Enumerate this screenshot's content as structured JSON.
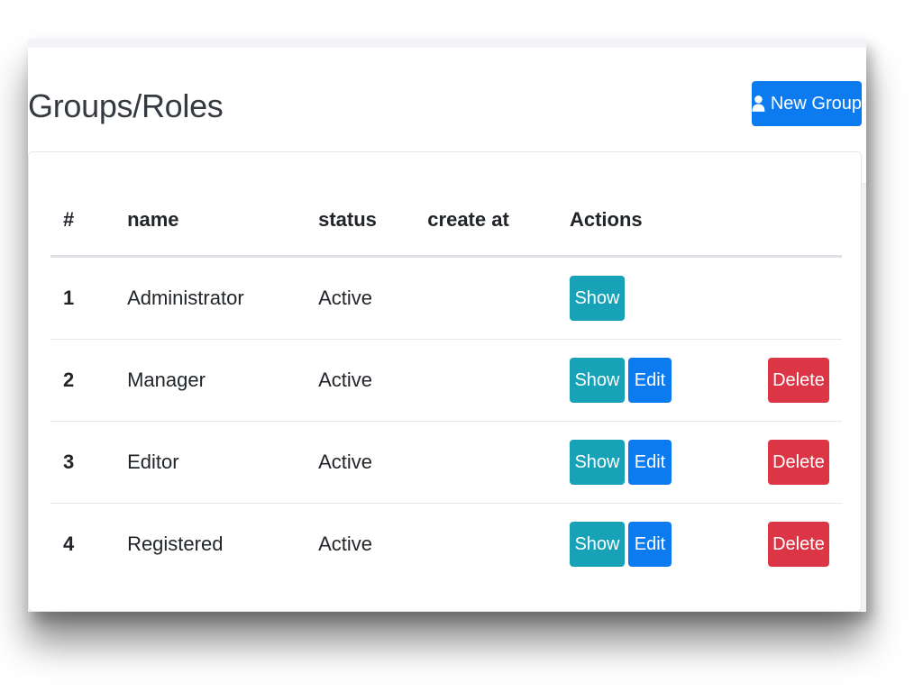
{
  "header": {
    "title": "Groups/Roles",
    "new_button_label": "New Group",
    "new_button_icon": "user-icon"
  },
  "table": {
    "columns": [
      "#",
      "name",
      "status",
      "create at",
      "Actions"
    ],
    "rows": [
      {
        "num": "1",
        "name": "Administrator",
        "status": "Active",
        "create_at": "",
        "show": "Show"
      },
      {
        "num": "2",
        "name": "Manager",
        "status": "Active",
        "create_at": "",
        "show": "Show",
        "edit": "Edit",
        "delete": "Delete"
      },
      {
        "num": "3",
        "name": "Editor",
        "status": "Active",
        "create_at": "",
        "show": "Show",
        "edit": "Edit",
        "delete": "Delete"
      },
      {
        "num": "4",
        "name": "Registered",
        "status": "Active",
        "create_at": "",
        "show": "Show",
        "edit": "Edit",
        "delete": "Delete"
      }
    ]
  },
  "colors": {
    "primary": "#0d7bf0",
    "info": "#17a2b8",
    "danger": "#dc3545"
  }
}
